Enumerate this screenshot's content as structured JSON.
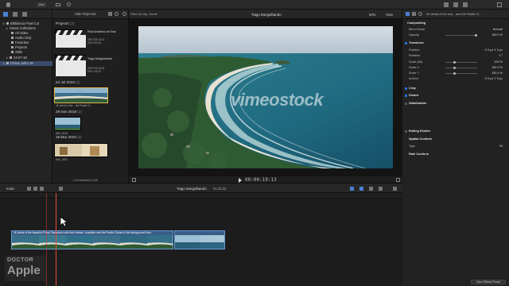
{
  "topbar": {
    "button_label": "Bra"
  },
  "library": {
    "items": [
      {
        "label": "Biblioteca Final Cut"
      },
      {
        "label": "Smart Collections"
      },
      {
        "label": "All Video"
      },
      {
        "label": "Audio Only"
      },
      {
        "label": "Favorites"
      },
      {
        "label": "Projects"
      },
      {
        "label": "Stills"
      },
      {
        "label": "24-07-18"
      },
      {
        "label": "Férias Julho 18"
      }
    ]
  },
  "browser": {
    "header": "Hide Rejected",
    "sections": [
      {
        "label": "Projects",
        "count": "(2)"
      },
      {
        "label": "24 Jul 2018",
        "count": "(1)"
      },
      {
        "label": "29 Nov 2018",
        "count": "(1)"
      },
      {
        "label": "18 Mar 2018",
        "count": "(2)"
      }
    ],
    "projects": [
      {
        "name": "Raul Andarino de Elsa",
        "date": "24/07/18 15:47",
        "duration": "00:00:00:04"
      },
      {
        "name": "Tiago Margulhando",
        "date": "24/07/18 15:24",
        "duration": "00:01:32:23"
      }
    ],
    "clip_caption": "4K aerial of the... the Pacific O...",
    "clip2_caption": "IMG_0578",
    "clip3_caption": "IMG_0597",
    "status": "1 of 6 selected, 21:28"
  },
  "viewer": {
    "title": "Tiago Mergulhando",
    "search": "Filter All Clip, Scene",
    "zoom": "50%",
    "view_label": "View",
    "timecode": "00:00:19:13",
    "watermark": "vimeostock"
  },
  "inspector": {
    "header": "4K aerial of the bea... and the Pacific O...",
    "compositing_title": "Compositing",
    "rows": [
      {
        "label": "Blend Mode",
        "value": "Normal"
      },
      {
        "label": "Opacity",
        "value": "100.0 %"
      },
      {
        "label": "Transform",
        "value": ""
      },
      {
        "label": "Position",
        "value": "X 0 px   Y 0 px"
      },
      {
        "label": "Rotation",
        "value": "0 °"
      },
      {
        "label": "Scale (All)",
        "value": "100 %"
      },
      {
        "label": "Scale X",
        "value": "100.0 %"
      },
      {
        "label": "Scale Y",
        "value": "100.0 %"
      },
      {
        "label": "Anchor",
        "value": "X 0 px   Y 0 px"
      },
      {
        "label": "Crop",
        "value": ""
      },
      {
        "label": "Distort",
        "value": ""
      },
      {
        "label": "Stabilization",
        "value": ""
      },
      {
        "label": "Rolling Shutter",
        "value": ""
      },
      {
        "label": "Spatial Conform",
        "value": ""
      },
      {
        "label": "Type",
        "value": "Fit"
      },
      {
        "label": "Rate Conform",
        "value": ""
      }
    ],
    "save_preset": "Save Effects Preset"
  },
  "timeline": {
    "index_label": "Index",
    "project_name": "Tiago Mergulhando",
    "duration": "01:32:23",
    "clip_label": "4K aerial of the beautiful Playa Tamarindo with lush forests, coastline and the Pacific Ocean in the background from...",
    "colors": {
      "clip": "#3a5c89",
      "playhead": "#e84b3a",
      "accent": "#2b6fd6"
    }
  },
  "logo": {
    "line1": "DOCTOR",
    "line2": "Apple"
  }
}
